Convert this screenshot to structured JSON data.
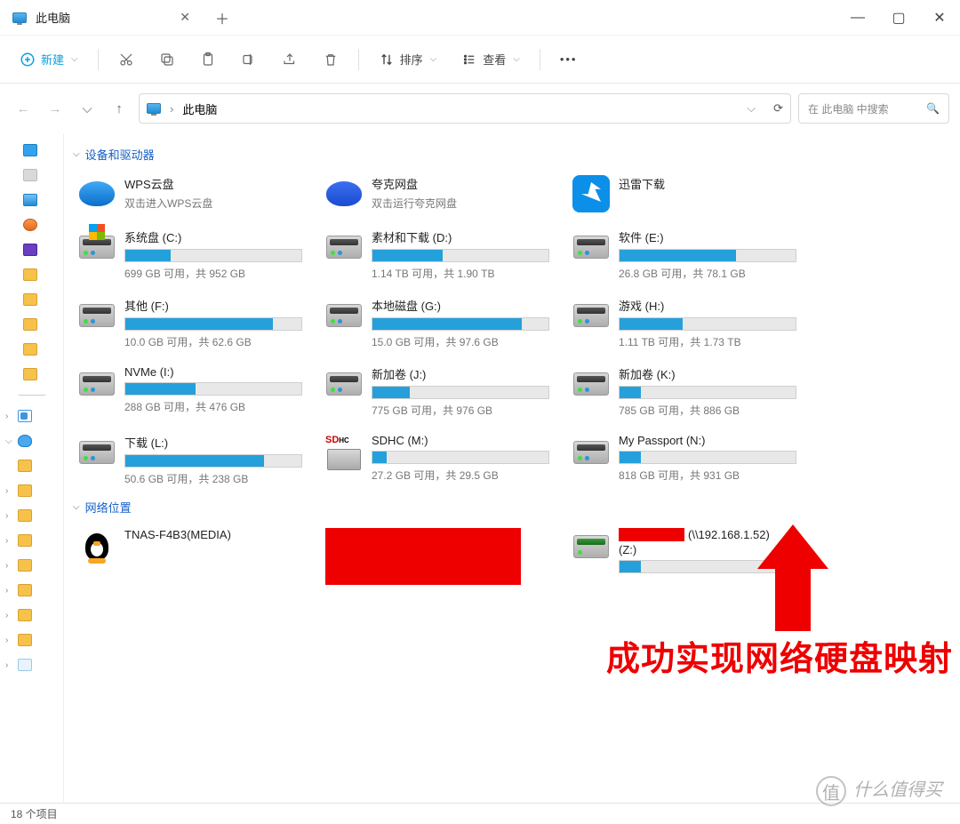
{
  "window": {
    "tab_title": "此电脑",
    "new_label": "新建",
    "sort_label": "排序",
    "view_label": "查看",
    "breadcrumb": "此电脑",
    "search_placeholder": "在 此电脑 中搜索",
    "status": "18 个项目"
  },
  "groups": {
    "devices": "设备和驱动器",
    "network": "网络位置"
  },
  "cloud_drives": [
    {
      "name": "WPS云盘",
      "sub": "双击进入WPS云盘",
      "icon": "wps"
    },
    {
      "name": "夸克网盘",
      "sub": "双击运行夸克网盘",
      "icon": "quark"
    },
    {
      "name": "迅雷下载",
      "sub": "",
      "icon": "xunlei"
    }
  ],
  "drives": [
    {
      "name": "系统盘 (C:)",
      "free": "699 GB 可用，共 952 GB",
      "pct": 26,
      "icon": "win"
    },
    {
      "name": "素材和下载 (D:)",
      "free": "1.14 TB 可用，共 1.90 TB",
      "pct": 40,
      "icon": "disk"
    },
    {
      "name": "软件 (E:)",
      "free": "26.8 GB 可用，共 78.1 GB",
      "pct": 66,
      "icon": "disk"
    },
    {
      "name": "其他 (F:)",
      "free": "10.0 GB 可用，共 62.6 GB",
      "pct": 84,
      "icon": "disk"
    },
    {
      "name": "本地磁盘 (G:)",
      "free": "15.0 GB 可用，共 97.6 GB",
      "pct": 85,
      "icon": "disk"
    },
    {
      "name": "游戏 (H:)",
      "free": "1.11 TB 可用，共 1.73 TB",
      "pct": 36,
      "icon": "disk"
    },
    {
      "name": "NVMe (I:)",
      "free": "288 GB 可用，共 476 GB",
      "pct": 40,
      "icon": "disk"
    },
    {
      "name": "新加卷 (J:)",
      "free": "775 GB 可用，共 976 GB",
      "pct": 21,
      "icon": "disk"
    },
    {
      "name": "新加卷 (K:)",
      "free": "785 GB 可用，共 886 GB",
      "pct": 12,
      "icon": "disk"
    },
    {
      "name": "下载 (L:)",
      "free": "50.6 GB 可用，共 238 GB",
      "pct": 79,
      "icon": "disk"
    },
    {
      "name": "SDHC (M:)",
      "free": "27.2 GB 可用，共 29.5 GB",
      "pct": 8,
      "icon": "sdhc"
    },
    {
      "name": "My Passport (N:)",
      "free": "818 GB 可用，共 931 GB",
      "pct": 12,
      "icon": "disk"
    }
  ],
  "network_drives": {
    "tnas": "TNAS-F4B3(MEDIA)",
    "z_suffix": "(\\\\192.168.1.52)",
    "z_letter": "(Z:)"
  },
  "annotation": "成功实现网络硬盘映射",
  "watermark": {
    "circle": "值",
    "text": "什么值得买"
  }
}
